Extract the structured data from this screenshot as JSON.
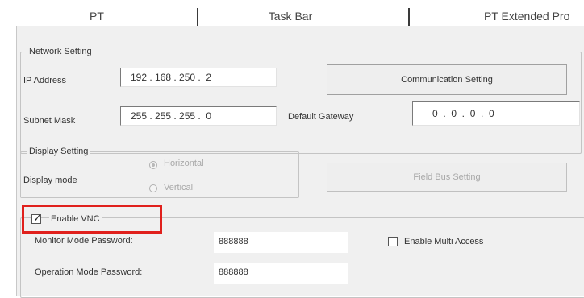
{
  "tabs": [
    {
      "label": "PT"
    },
    {
      "label": "Task Bar"
    },
    {
      "label": "PT Extended Pro"
    }
  ],
  "network_setting": {
    "legend": "Network Setting",
    "ip_address_label": "IP Address",
    "ip_address_value": "192 . 168 . 250 .  2",
    "communication_button": "Communication Setting",
    "subnet_mask_label": "Subnet Mask",
    "subnet_mask_value": "255 . 255 . 255 .  0",
    "default_gateway_label": "Default Gateway",
    "default_gateway_value": "0  .  0  .  0  .  0"
  },
  "display_setting": {
    "legend": "Display Setting",
    "mode_label": "Display mode",
    "horizontal_label": "Horizontal",
    "vertical_label": "Vertical",
    "selected": "Horizontal",
    "field_bus_button": "Field Bus Setting"
  },
  "vnc": {
    "enable_label": "Enable VNC",
    "enabled": true,
    "monitor_password_label": "Monitor Mode Password:",
    "monitor_password_value": "888888",
    "operation_password_label": "Operation Mode Password:",
    "operation_password_value": "888888",
    "multi_access_label": "Enable Multi Access",
    "multi_access_checked": false
  },
  "colors": {
    "highlight": "#e0201c",
    "panel_bg": "#f0f0f0"
  }
}
